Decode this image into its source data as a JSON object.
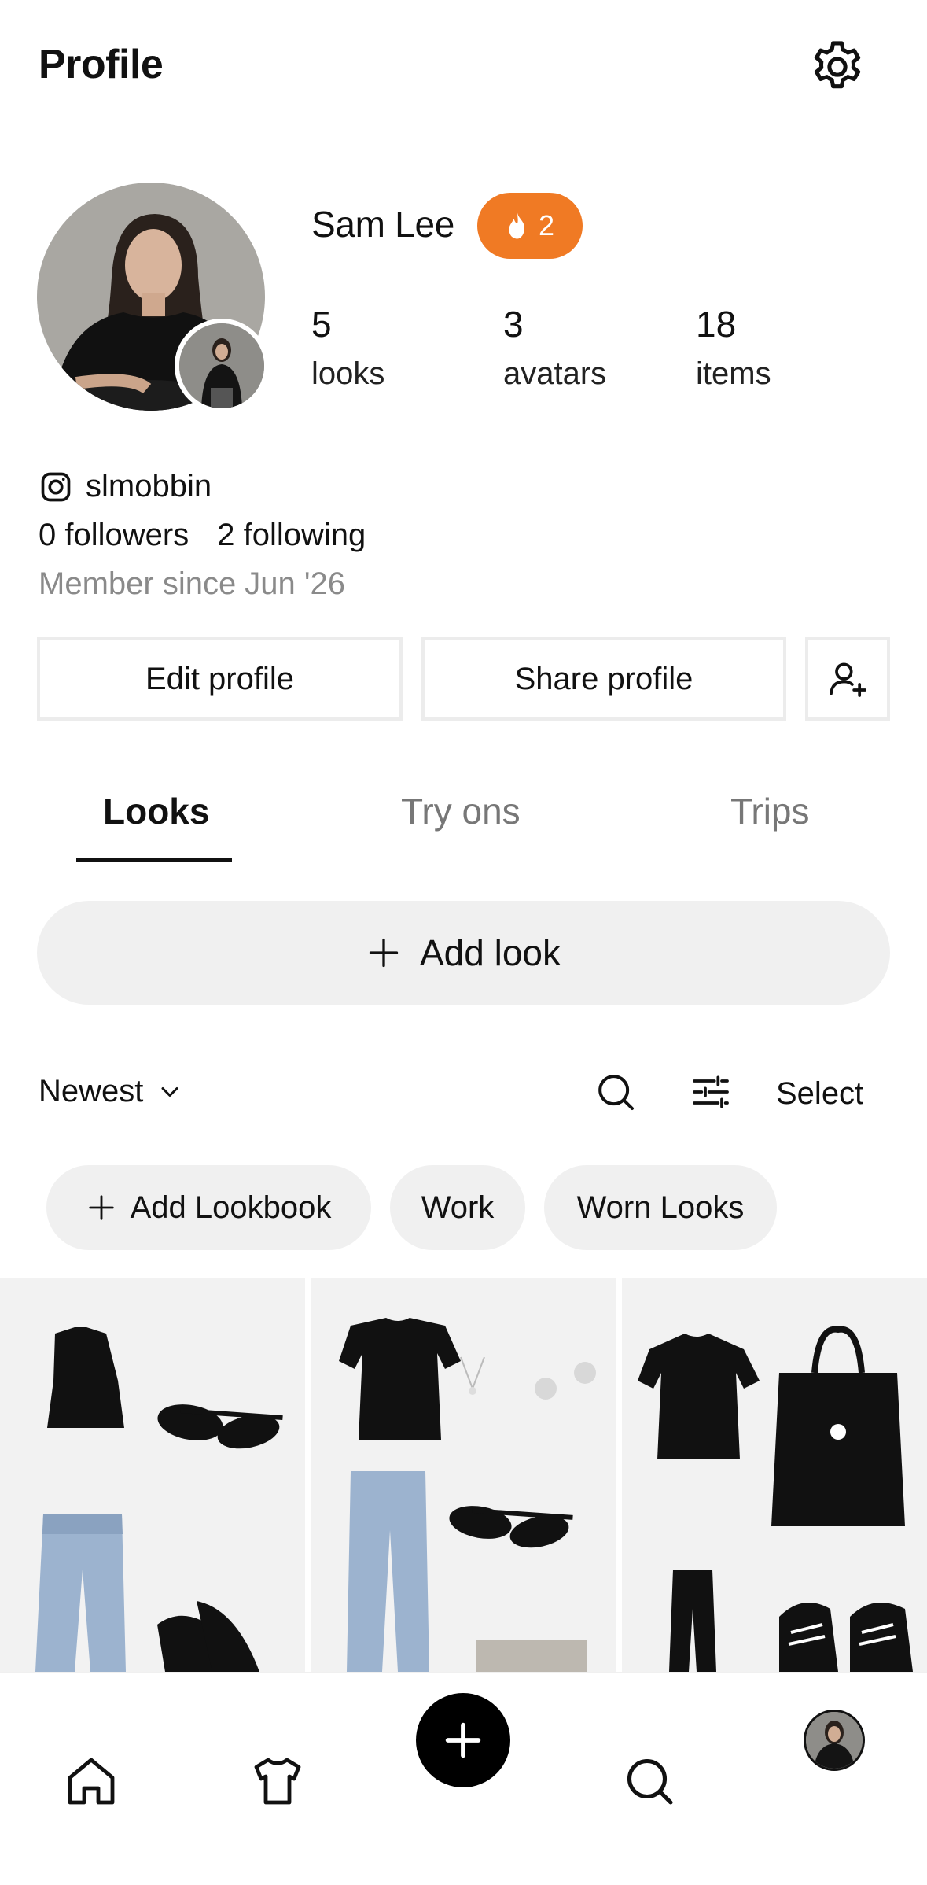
{
  "header": {
    "title": "Profile",
    "settings_icon": "gear-icon"
  },
  "profile": {
    "name": "Sam Lee",
    "streak_count": "2",
    "streak_color": "#f07a24",
    "stats": [
      {
        "value": "5",
        "label": "looks"
      },
      {
        "value": "3",
        "label": "avatars"
      },
      {
        "value": "18",
        "label": "items"
      }
    ],
    "instagram_handle": "slmobbin",
    "followers_count": "0",
    "followers_label": "followers",
    "following_count": "2",
    "following_label": "following",
    "member_since": "Member since Jun '26"
  },
  "actions": {
    "edit_profile": "Edit profile",
    "share_profile": "Share profile"
  },
  "tabs": [
    {
      "label": "Looks",
      "active": true
    },
    {
      "label": "Try ons",
      "active": false
    },
    {
      "label": "Trips",
      "active": false
    }
  ],
  "add_look_label": "Add look",
  "toolbar": {
    "sort_label": "Newest",
    "select_label": "Select"
  },
  "chips": [
    {
      "label": "Add Lookbook"
    },
    {
      "label": "Work"
    },
    {
      "label": "Worn Looks"
    }
  ],
  "looks_grid": [
    {
      "items": [
        "black sleeveless top",
        "black sunglasses",
        "light wash jeans",
        "black heels"
      ]
    },
    {
      "items": [
        "black t-shirt",
        "necklace",
        "earrings",
        "light wash jeans",
        "black sunglasses",
        "silver bag"
      ]
    },
    {
      "items": [
        "black t-shirt",
        "black tote bag",
        "black leggings",
        "black sneakers"
      ]
    }
  ]
}
